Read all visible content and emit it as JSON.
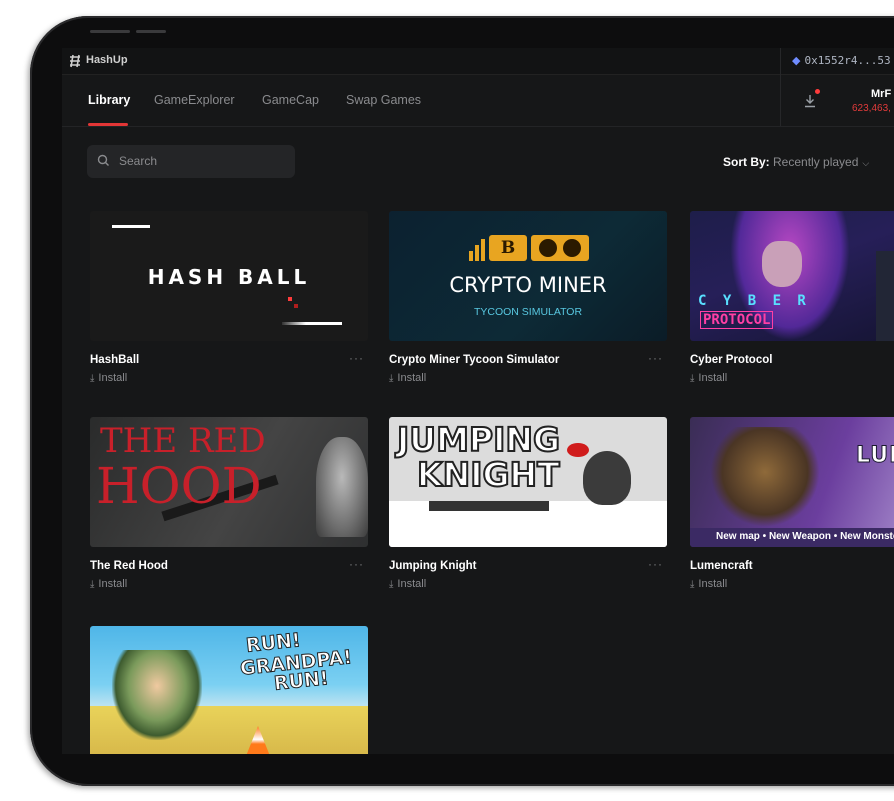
{
  "app": {
    "name": "HashUp"
  },
  "wallet": {
    "address": "0x1552r4...53",
    "currency_icon": "ethereum-icon"
  },
  "nav": {
    "tabs": [
      {
        "label": "Library",
        "active": true
      },
      {
        "label": "GameExplorer",
        "active": false
      },
      {
        "label": "GameCap",
        "active": false
      },
      {
        "label": "Swap Games",
        "active": false
      }
    ]
  },
  "user": {
    "name": "MrF",
    "balance": "623,463,"
  },
  "search": {
    "placeholder": "Search"
  },
  "sort": {
    "label": "Sort By:",
    "value": "Recently played"
  },
  "games": [
    {
      "title": "HashBall",
      "action": "Install",
      "art_text": [
        "HASH BALL"
      ]
    },
    {
      "title": "Crypto Miner Tycoon Simulator",
      "action": "Install",
      "art_text": [
        "CRYPTO MINER",
        "TYCOON SIMULATOR"
      ]
    },
    {
      "title": "Cyber Protocol",
      "action": "Install",
      "art_text": [
        "C Y B E R",
        "PROTOCOL"
      ]
    },
    {
      "title": "The Red Hood",
      "action": "Install",
      "art_text": [
        "THE RED",
        "HOOD"
      ]
    },
    {
      "title": "Jumping Knight",
      "action": "Install",
      "art_text": [
        "JUMPING",
        "KNIGHT"
      ]
    },
    {
      "title": "Lumencraft",
      "action": "Install",
      "art_text": [
        "LUMENC",
        "New map • New Weapon • New Monster •"
      ]
    },
    {
      "title": "",
      "action": "",
      "art_text": [
        "RUN!",
        "GRANDPA!",
        "RUN!"
      ]
    }
  ],
  "more_label": "···",
  "colors": {
    "accent": "#e23636",
    "background": "#161718",
    "balance": "#e23b3b"
  }
}
